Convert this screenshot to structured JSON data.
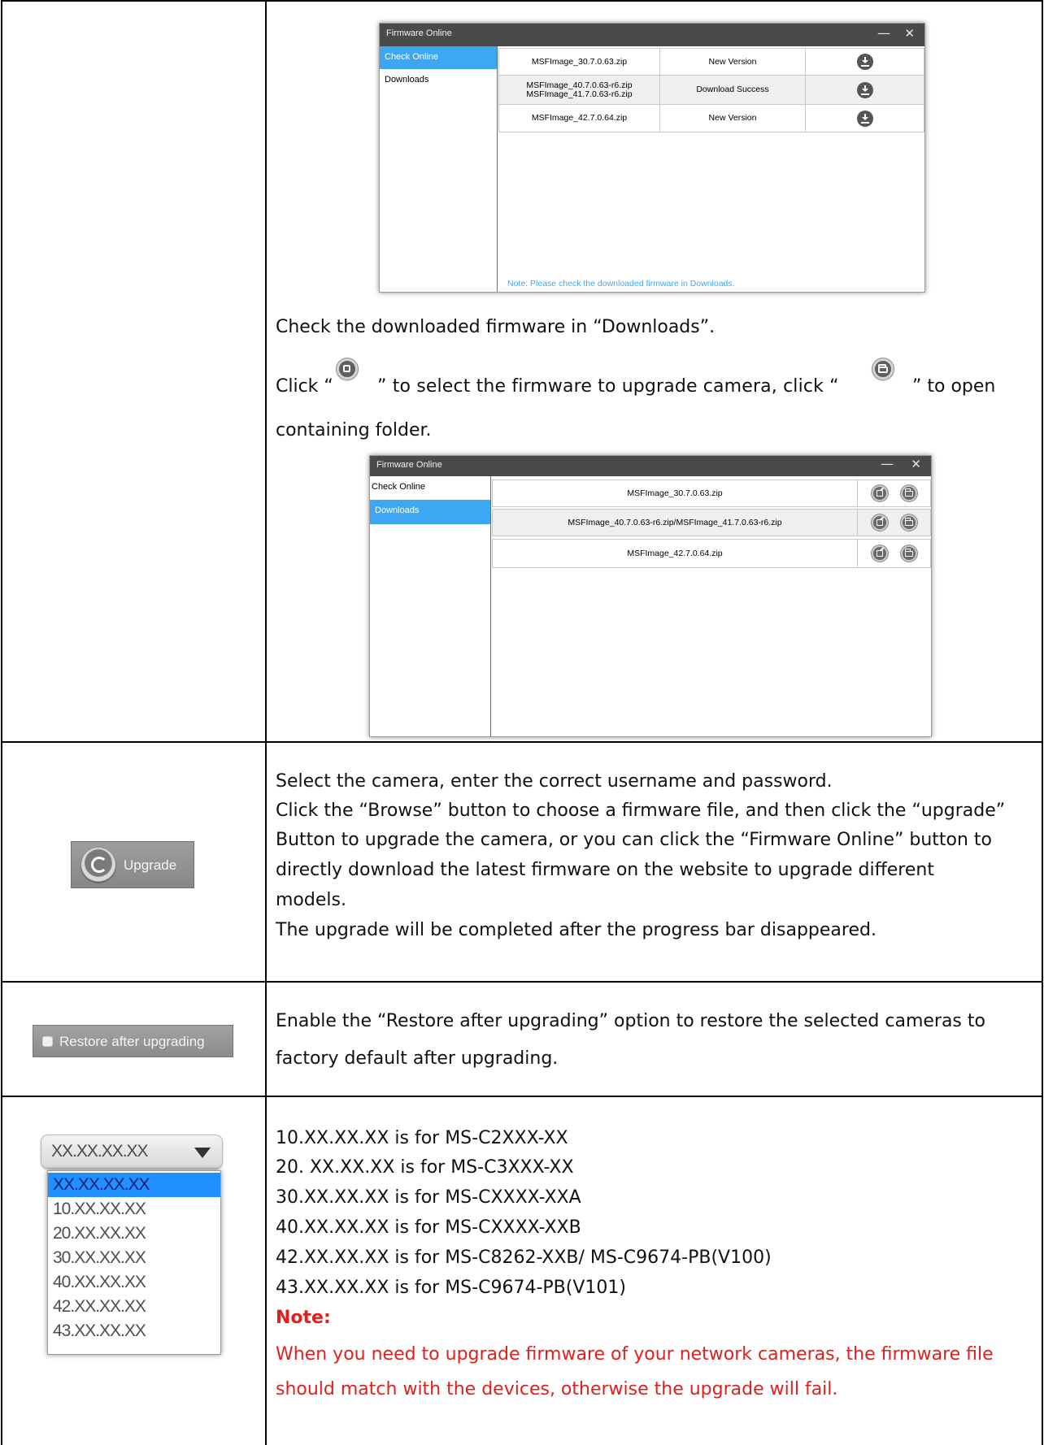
{
  "dialog1": {
    "title": "Firmware Online",
    "min_icon": "minimize-icon",
    "close_icon": "close-icon",
    "sidebar": [
      {
        "label": "Check Online",
        "active": true
      },
      {
        "label": "Downloads",
        "active": false
      }
    ],
    "rows": [
      {
        "file": "MSFImage_30.7.0.63.zip",
        "status": "New Version",
        "action_icon": "download-icon"
      },
      {
        "file": "MSFImage_40.7.0.63-r6.zip\nMSFImage_41.7.0.63-r6.zip",
        "status": "Download Success",
        "action_icon": "download-icon"
      },
      {
        "file": "MSFImage_42.7.0.64.zip",
        "status": "New Version",
        "action_icon": "download-icon"
      }
    ],
    "note": "Note: Please check the downloaded firmware in Downloads."
  },
  "text": {
    "check_downloads": "Check the downloaded firmware in “Downloads”.",
    "click_part1": "Click “",
    "click_part2": "” to select the firmware to upgrade camera, click “",
    "click_part3": "” to open",
    "click_part4": "containing folder.",
    "upgrade_desc": [
      "Select the camera, enter the correct username and password.",
      "Click the “Browse” button to choose a firmware file, and then click the “upgrade”",
      "Button to upgrade the camera, or you can click the “Firmware Online” button to",
      "directly download the latest firmware on the website to upgrade different",
      "models.",
      "The upgrade will be completed after the progress bar disappeared."
    ],
    "restore_desc": [
      "Enable the “Restore after upgrading” option to restore the selected cameras to",
      "factory default after upgrading."
    ],
    "version_desc": [
      "10.XX.XX.XX is for MS-C2XXX-XX",
      "20. XX.XX.XX is for MS-C3XXX-XX",
      "30.XX.XX.XX is for MS-CXXXX-XXA",
      "40.XX.XX.XX is for MS-CXXXX-XXB",
      "42.XX.XX.XX is for MS-C8262-XXB/ MS-C9674-PB(V100)",
      "43.XX.XX.XX is for MS-C9674-PB(V101)"
    ],
    "note_label": "Note:",
    "note_desc": [
      "When you need to upgrade firmware of your network cameras, the firmware file",
      "should match with the devices, otherwise the upgrade will fail."
    ]
  },
  "dialog2": {
    "title": "Firmware Online",
    "min_icon": "minimize-icon",
    "close_icon": "close-icon",
    "sidebar": [
      {
        "label": "Check Online",
        "active": false
      },
      {
        "label": "Downloads",
        "active": true
      }
    ],
    "rows": [
      {
        "file": "MSFImage_30.7.0.63.zip",
        "icons": [
          "select-firmware-icon",
          "open-folder-icon"
        ]
      },
      {
        "file": "MSFImage_40.7.0.63-r6.zip/MSFImage_41.7.0.63-r6.zip",
        "icons": [
          "select-firmware-icon",
          "open-folder-icon"
        ]
      },
      {
        "file": "MSFImage_42.7.0.64.zip",
        "icons": [
          "select-firmware-icon",
          "open-folder-icon"
        ]
      }
    ]
  },
  "upgrade_button": {
    "label": "Upgrade",
    "icon": "upgrade-icon"
  },
  "restore_checkbox": {
    "label": "Restore after upgrading",
    "checked": false
  },
  "version_select": {
    "value": "XX.XX.XX.XX",
    "options": [
      "XX.XX.XX.XX",
      "10.XX.XX.XX",
      "20.XX.XX.XX",
      "30.XX.XX.XX",
      "40.XX.XX.XX",
      "42.XX.XX.XX",
      "43.XX.XX.XX"
    ],
    "selected_index": 0
  },
  "colors": {
    "accent_blue": "#3ea7f2",
    "note_red": "#e0201d",
    "titlebar": "#4a4a4a"
  }
}
